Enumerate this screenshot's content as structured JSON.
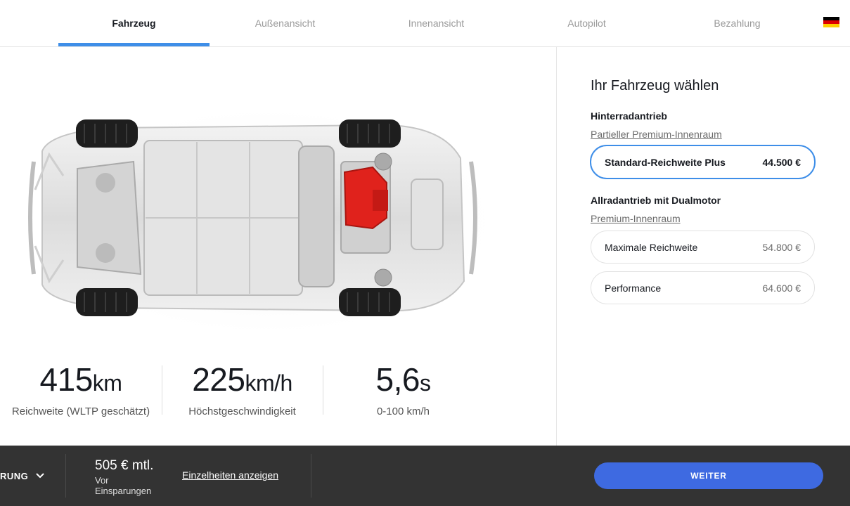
{
  "nav": {
    "tabs": [
      {
        "label": "Fahrzeug",
        "active": true
      },
      {
        "label": "Außenansicht",
        "active": false
      },
      {
        "label": "Innenansicht",
        "active": false
      },
      {
        "label": "Autopilot",
        "active": false
      },
      {
        "label": "Bezahlung",
        "active": false
      }
    ],
    "flag_icon": "germany-flag-icon",
    "flag_colors": [
      "#000000",
      "#dd0000",
      "#ffce00"
    ]
  },
  "stats": [
    {
      "value": "415",
      "unit": "km",
      "label": "Reichweite (WLTP geschätzt)"
    },
    {
      "value": "225",
      "unit": "km/h",
      "label": "Höchstgeschwindigkeit"
    },
    {
      "value": "5,6",
      "unit": "s",
      "label": "0-100 km/h"
    }
  ],
  "panel": {
    "title": "Ihr Fahrzeug wählen",
    "groups": [
      {
        "title": "Hinterradantrieb",
        "link": "Partieller Premium-Innenraum",
        "options": [
          {
            "name": "Standard-Reichweite Plus",
            "price": "44.500 €",
            "selected": true
          }
        ]
      },
      {
        "title": "Allradantrieb mit Dualmotor",
        "link": "Premium-Innenraum",
        "options": [
          {
            "name": "Maximale Reichweite",
            "price": "54.800 €",
            "selected": false
          },
          {
            "name": "Performance",
            "price": "64.600 €",
            "selected": false
          }
        ]
      }
    ]
  },
  "bottom": {
    "left_label": "RUNG",
    "price": "505 € mtl.",
    "price_sub_1": "Vor",
    "price_sub_2": "Einsparungen",
    "details_link": "Einzelheiten anzeigen",
    "next_label": "WEITER"
  },
  "colors": {
    "accent": "#3e8ee8",
    "button": "#3e6ae1",
    "bottom_bar": "#333333",
    "motor_red": "#e0221c"
  }
}
